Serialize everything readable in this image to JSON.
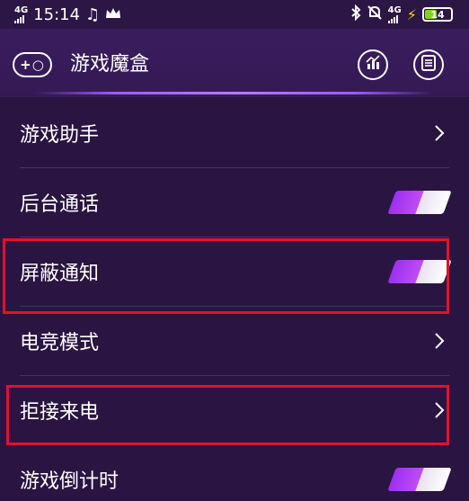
{
  "status_bar": {
    "network_left": "4G",
    "time": "15:14",
    "network_right": "4G",
    "battery": "14",
    "music_icon": "music-note-icon",
    "crown_icon": "crown-icon",
    "bluetooth_icon": "bluetooth-icon",
    "mute_icon": "mute-bell-icon",
    "charging_icon": "charging-bolt-icon"
  },
  "header": {
    "title": "游戏魔盒",
    "left_icon_text": "+○",
    "left_icon": "gamepad-icon",
    "right_icons": [
      "stats-icon",
      "list-icon"
    ]
  },
  "settings": [
    {
      "label": "游戏助手",
      "control": "chevron"
    },
    {
      "label": "后台通话",
      "control": "toggle",
      "on": true
    },
    {
      "label": "屏蔽通知",
      "control": "toggle",
      "on": true,
      "highlighted": true
    },
    {
      "label": "电竞模式",
      "control": "chevron"
    },
    {
      "label": "拒接来电",
      "control": "chevron",
      "highlighted": true
    },
    {
      "label": "游戏倒计时",
      "control": "toggle",
      "on": true
    }
  ],
  "colors": {
    "background": "#2a1442",
    "accent": "#9a30f0",
    "highlight_border": "#e0122a"
  }
}
